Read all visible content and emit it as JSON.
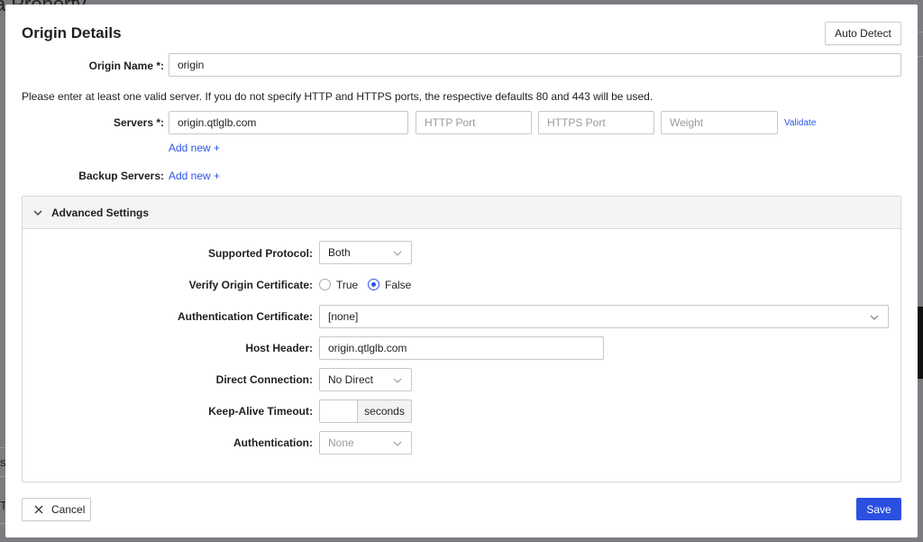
{
  "background": {
    "page_title_fragment": "a Property",
    "row_fragments": [
      "s",
      "T"
    ]
  },
  "modal": {
    "title": "Origin Details",
    "auto_detect_label": "Auto Detect",
    "origin_name": {
      "label": "Origin Name *:",
      "value": "origin"
    },
    "hint": "Please enter at least one valid server. If you do not specify HTTP and HTTPS ports, the respective defaults 80 and 443 will be used.",
    "servers": {
      "label": "Servers *:",
      "server_value": "origin.qtlglb.com",
      "http_port_placeholder": "HTTP Port",
      "https_port_placeholder": "HTTPS Port",
      "weight_placeholder": "Weight",
      "validate_label": "Validate",
      "add_new_label": "Add new +"
    },
    "backup_servers": {
      "label": "Backup Servers:",
      "add_new_label": "Add new +"
    },
    "advanced": {
      "title": "Advanced Settings",
      "supported_protocol": {
        "label": "Supported Protocol:",
        "value": "Both"
      },
      "verify_origin_certificate": {
        "label": "Verify Origin Certificate:",
        "options": [
          "True",
          "False"
        ],
        "selected": "False"
      },
      "authentication_certificate": {
        "label": "Authentication Certificate:",
        "value": "[none]"
      },
      "host_header": {
        "label": "Host Header:",
        "value": "origin.qtlglb.com"
      },
      "direct_connection": {
        "label": "Direct Connection:",
        "value": "No Direct"
      },
      "keep_alive_timeout": {
        "label": "Keep-Alive Timeout:",
        "value": "",
        "unit": "seconds"
      },
      "authentication": {
        "label": "Authentication:",
        "value": "None"
      }
    },
    "cancel_label": "Cancel",
    "save_label": "Save",
    "colors": {
      "accent": "#2b4fe0",
      "link": "#2b55e6"
    }
  }
}
